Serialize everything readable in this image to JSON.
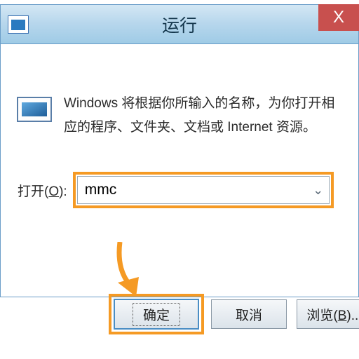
{
  "window": {
    "title": "运行",
    "close_x": "X"
  },
  "message": {
    "text": "Windows 将根据你所输入的名称，为你打开相应的程序、文件夹、文档或 Internet 资源。"
  },
  "open": {
    "label_prefix": "打开(",
    "label_key": "O",
    "label_suffix": "):",
    "value": "mmc"
  },
  "buttons": {
    "ok": "确定",
    "cancel": "取消",
    "browse_prefix": "浏览(",
    "browse_key": "B",
    "browse_suffix": ")..."
  },
  "annotation": {
    "highlight_color": "#f59a24"
  }
}
